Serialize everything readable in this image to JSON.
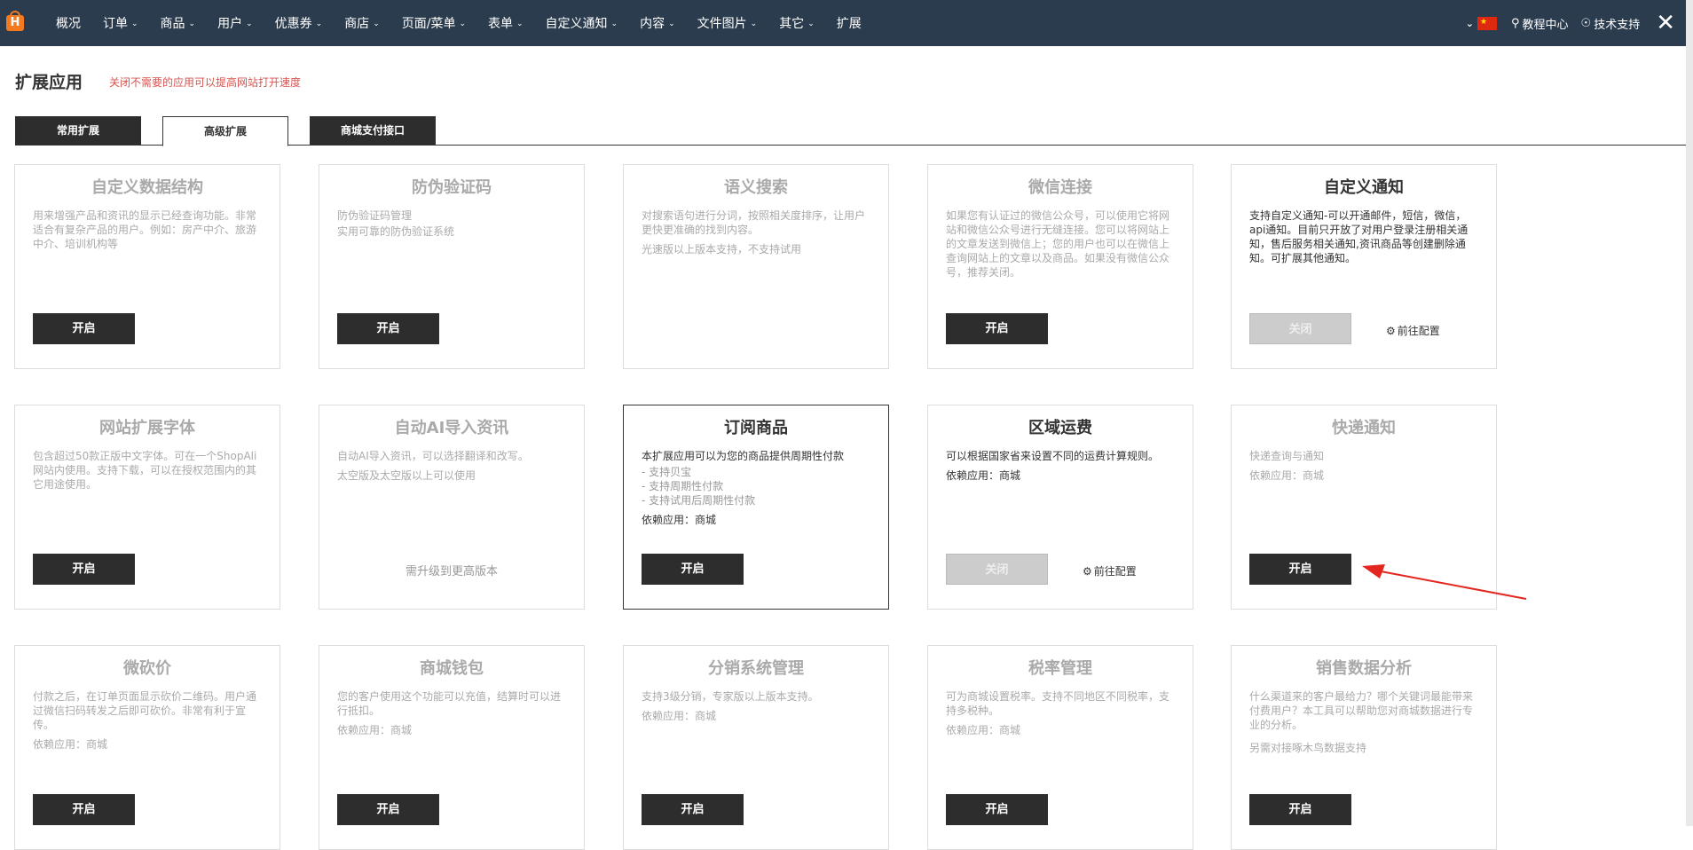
{
  "nav": {
    "logo": "H",
    "items": [
      {
        "label": "概况",
        "chevron": false
      },
      {
        "label": "订单",
        "chevron": true
      },
      {
        "label": "商品",
        "chevron": true
      },
      {
        "label": "用户",
        "chevron": true
      },
      {
        "label": "优惠券",
        "chevron": true
      },
      {
        "label": "商店",
        "chevron": true
      },
      {
        "label": "页面/菜单",
        "chevron": true
      },
      {
        "label": "表单",
        "chevron": true
      },
      {
        "label": "自定义通知",
        "chevron": true
      },
      {
        "label": "内容",
        "chevron": true
      },
      {
        "label": "文件图片",
        "chevron": true
      },
      {
        "label": "其它",
        "chevron": true
      },
      {
        "label": "扩展",
        "chevron": false
      }
    ],
    "tutorial": "教程中心",
    "support": "技术支持",
    "close_icon": "close-icon",
    "flag": "china-flag"
  },
  "header": {
    "title": "扩展应用",
    "hint": "关闭不需要的应用可以提高网站打开速度"
  },
  "tabs": [
    {
      "label": "常用扩展"
    },
    {
      "label": "高级扩展"
    },
    {
      "label": "商城支付接口"
    }
  ],
  "cards": [
    {
      "title": "自定义数据结构",
      "desc": [
        "用来增强产品和资讯的显示已经查询功能。非常适合有复杂产品的用户。例如：房产中介、旅游中介、培训机构等"
      ],
      "button": "开启"
    },
    {
      "title": "防伪验证码",
      "desc": [
        "防伪验证码管理",
        "实用可靠的防伪验证系统"
      ],
      "button": "开启"
    },
    {
      "title": "语义搜索",
      "desc": [
        "对搜索语句进行分词，按照相关度排序，让用户更快更准确的找到内容。",
        "光速版以上版本支持，不支持试用"
      ]
    },
    {
      "title": "微信连接",
      "desc": [
        "如果您有认证过的微信公众号，可以使用它将网站和微信公众号进行无缝连接。您可以将网站上的文章发送到微信上；您的用户也可以在微信上查询网站上的文章以及商品。如果没有微信公众号，推荐关闭。"
      ],
      "button": "开启"
    },
    {
      "title": "自定义通知",
      "desc": [
        "支持自定义通知-可以开通邮件，短信，微信，api通知。目前只开放了对用户登录注册相关通知，售后服务相关通知,资讯商品等创建删除通知。可扩展其他通知。"
      ],
      "button": "关闭",
      "config": "前往配置"
    },
    {
      "title": "网站扩展字体",
      "desc": [
        "包含超过50款正版中文字体。可在一个ShopAli网站内使用。支持下载，可以在授权范围内的其它用途使用。"
      ],
      "button": "开启"
    },
    {
      "title": "自动AI导入资讯",
      "desc": [
        "自动AI导入资讯，可以选择翻译和改写。",
        "太空版及太空版以上可以使用"
      ],
      "upgrade": "需升级到更高版本"
    },
    {
      "title": "订阅商品",
      "desc": [
        "本扩展应用可以为您的商品提供周期性付款"
      ],
      "list": [
        "- 支持贝宝",
        "- 支持周期性付款",
        "- 支持试用后周期性付款"
      ],
      "dep": "依赖应用：商城",
      "button": "开启"
    },
    {
      "title": "区域运费",
      "desc": [
        "可以根据国家省来设置不同的运费计算规则。",
        "依赖应用：商城"
      ],
      "button": "关闭",
      "config": "前往配置"
    },
    {
      "title": "快递通知",
      "desc": [
        "快递查询与通知",
        "依赖应用：商城"
      ],
      "button": "开启"
    },
    {
      "title": "微砍价",
      "desc": [
        "付款之后，在订单页面显示砍价二维码。用户通过微信扫码转发之后即可砍价。非常有利于宣传。",
        "依赖应用：商城"
      ],
      "button": "开启"
    },
    {
      "title": "商城钱包",
      "desc": [
        "您的客户使用这个功能可以充值，结算时可以进行抵扣。",
        "依赖应用：商城"
      ],
      "button": "开启"
    },
    {
      "title": "分销系统管理",
      "desc": [
        "支持3级分销，专家版以上版本支持。",
        "依赖应用：商城"
      ],
      "button": "开启"
    },
    {
      "title": "税率管理",
      "desc": [
        "可为商城设置税率。支持不同地区不同税率，支持多税种。",
        "依赖应用：商城"
      ],
      "button": "开启"
    },
    {
      "title": "销售数据分析",
      "desc": [
        "什么渠道来的客户最给力？哪个关键词最能带来付费用户？本工具可以帮助您对商城数据进行专业的分析。",
        "另需对接啄木鸟数据支持"
      ],
      "button": "开启"
    }
  ]
}
